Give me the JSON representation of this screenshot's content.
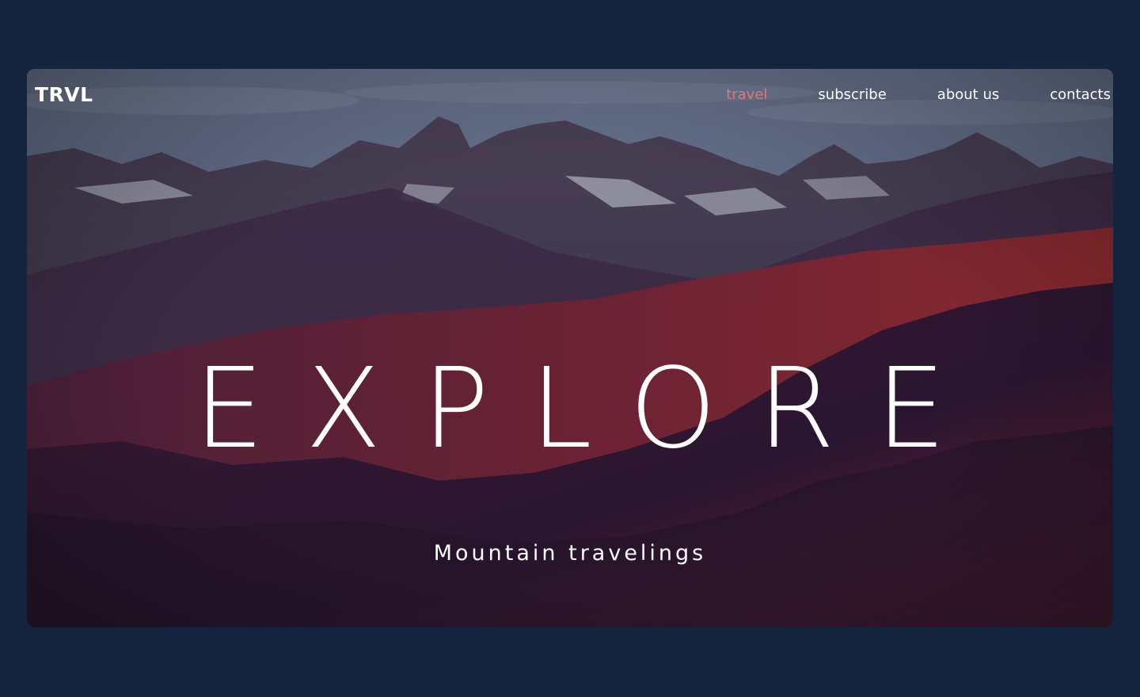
{
  "brand": {
    "logo": "TRVL"
  },
  "nav": {
    "items": [
      {
        "label": "travel",
        "active": true
      },
      {
        "label": "subscribe",
        "active": false
      },
      {
        "label": "about us",
        "active": false
      },
      {
        "label": "contacts",
        "active": false
      }
    ]
  },
  "hero": {
    "headline": "EXPLORE",
    "subtitle": "Mountain travelings",
    "image_description": "mountain-range-at-dusk"
  },
  "colors": {
    "page_background": "#15243d",
    "active_nav": "#d97a78",
    "text": "#ffffff"
  }
}
